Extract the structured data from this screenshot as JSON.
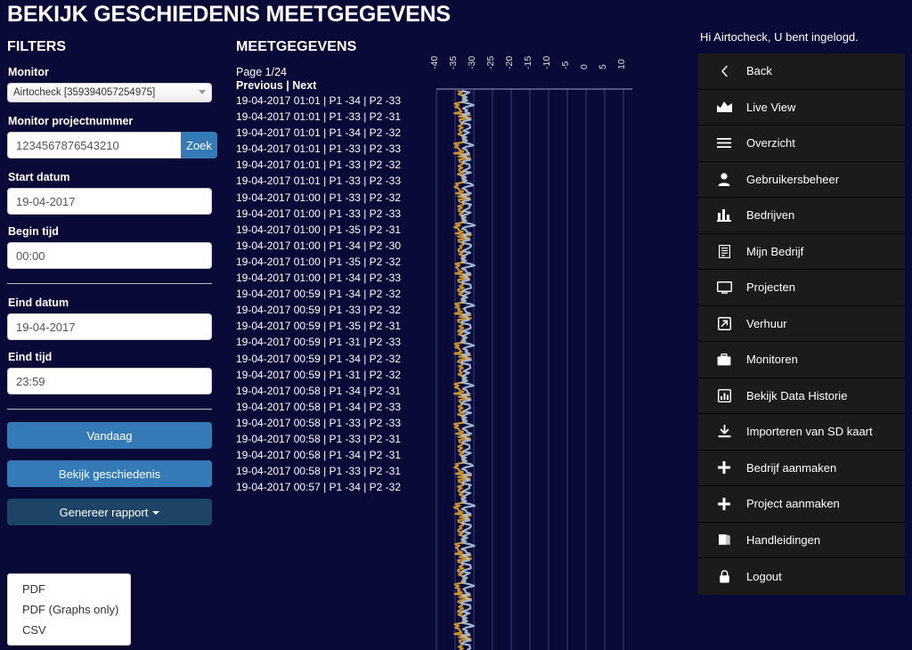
{
  "page": {
    "title": "BEKIJK GESCHIEDENIS MEETGEGEVENS",
    "background_color": "#0a0a38"
  },
  "filters": {
    "heading": "FILTERS",
    "monitor": {
      "label": "Monitor",
      "selected": "Airtocheck [359394057254975]",
      "options": [
        "Airtocheck [359394057254975]"
      ]
    },
    "projectnummer": {
      "label": "Monitor projectnummer",
      "value": "1234567876543210",
      "placeholder": "Monitor projectnummer",
      "search_label": "Zoek"
    },
    "start_datum": {
      "label": "Start datum",
      "value": "19-04-2017"
    },
    "begin_tijd": {
      "label": "Begin tijd",
      "value": "00:00"
    },
    "eind_datum": {
      "label": "Eind datum",
      "value": "19-04-2017"
    },
    "eind_tijd": {
      "label": "Eind tijd",
      "value": "23:59"
    },
    "buttons": {
      "vandaag": "Vandaag",
      "bekijk_geschiedenis": "Bekijk geschiedenis",
      "genereer_rapport": "Genereer rapport"
    },
    "report_menu": {
      "open": true,
      "items": [
        "PDF",
        "PDF (Graphs only)",
        "CSV"
      ]
    },
    "accent_color": "#337ab7",
    "dark_button_color": "#1d4466"
  },
  "measurements": {
    "heading": "MEETGEGEVENS",
    "page_label": "Page 1/24",
    "previous_label": "Previous",
    "separator": "|",
    "next_label": "Next",
    "rows": [
      "19-04-2017 01:01 | P1 -34 | P2 -33",
      "19-04-2017 01:01 | P1 -33 | P2 -31",
      "19-04-2017 01:01 | P1 -34 | P2 -32",
      "19-04-2017 01:01 | P1 -33 | P2 -33",
      "19-04-2017 01:01 | P1 -33 | P2 -32",
      "19-04-2017 01:01 | P1 -33 | P2 -33",
      "19-04-2017 01:00 | P1 -33 | P2 -32",
      "19-04-2017 01:00 | P1 -33 | P2 -33",
      "19-04-2017 01:00 | P1 -35 | P2 -31",
      "19-04-2017 01:00 | P1 -34 | P2 -30",
      "19-04-2017 01:00 | P1 -35 | P2 -32",
      "19-04-2017 01:00 | P1 -34 | P2 -33",
      "19-04-2017 00:59 | P1 -34 | P2 -32",
      "19-04-2017 00:59 | P1 -33 | P2 -32",
      "19-04-2017 00:59 | P1 -35 | P2 -31",
      "19-04-2017 00:59 | P1 -31 | P2 -33",
      "19-04-2017 00:59 | P1 -34 | P2 -32",
      "19-04-2017 00:59 | P1 -31 | P2 -32",
      "19-04-2017 00:58 | P1 -34 | P2 -31",
      "19-04-2017 00:58 | P1 -34 | P2 -33",
      "19-04-2017 00:58 | P1 -33 | P2 -33",
      "19-04-2017 00:58 | P1 -33 | P2 -31",
      "19-04-2017 00:58 | P1 -34 | P2 -31",
      "19-04-2017 00:58 | P1 -33 | P2 -31",
      "19-04-2017 00:57 | P1 -34 | P2 -32"
    ]
  },
  "chart_data": {
    "type": "line",
    "title": "",
    "xlabel": "",
    "ylabel": "",
    "orientation": "horizontal-axis-on-top",
    "grid": true,
    "axis_ticks": [
      -40,
      -35,
      -30,
      -25,
      -20,
      -15,
      -10,
      -5,
      0,
      5,
      10
    ],
    "xlim": [
      -40,
      10
    ],
    "legend": [],
    "series": [
      {
        "name": "P1",
        "color": "#d99a2b",
        "values": [
          -34,
          -33,
          -34,
          -33,
          -33,
          -33,
          -33,
          -33,
          -35,
          -34,
          -35,
          -34,
          -34,
          -33,
          -35,
          -31,
          -34,
          -31,
          -34,
          -34,
          -33,
          -33,
          -34,
          -33,
          -34
        ]
      },
      {
        "name": "P2",
        "color": "#a8c0d8",
        "values": [
          -33,
          -31,
          -32,
          -33,
          -32,
          -33,
          -32,
          -33,
          -31,
          -30,
          -32,
          -33,
          -32,
          -32,
          -31,
          -33,
          -32,
          -32,
          -31,
          -33,
          -33,
          -31,
          -31,
          -31,
          -32
        ]
      }
    ]
  },
  "sidebar": {
    "greeting": "Hi Airtocheck, U bent ingelogd.",
    "items": [
      {
        "label": "Back",
        "icon": "chevron-left-icon"
      },
      {
        "label": "Live View",
        "icon": "area-chart-icon"
      },
      {
        "label": "Overzicht",
        "icon": "list-icon"
      },
      {
        "label": "Gebruikersbeheer",
        "icon": "user-icon"
      },
      {
        "label": "Bedrijven",
        "icon": "bar-chart-icon"
      },
      {
        "label": "Mijn Bedrijf",
        "icon": "building-icon"
      },
      {
        "label": "Projecten",
        "icon": "monitor-icon"
      },
      {
        "label": "Verhuur",
        "icon": "external-link-icon"
      },
      {
        "label": "Monitoren",
        "icon": "briefcase-icon"
      },
      {
        "label": "Bekijk Data Historie",
        "icon": "bar-chart-box-icon"
      },
      {
        "label": "Importeren van SD kaart",
        "icon": "download-icon"
      },
      {
        "label": "Bedrijf aanmaken",
        "icon": "plus-icon"
      },
      {
        "label": "Project aanmaken",
        "icon": "plus-icon"
      },
      {
        "label": "Handleidingen",
        "icon": "book-icon"
      },
      {
        "label": "Logout",
        "icon": "lock-icon"
      }
    ]
  }
}
